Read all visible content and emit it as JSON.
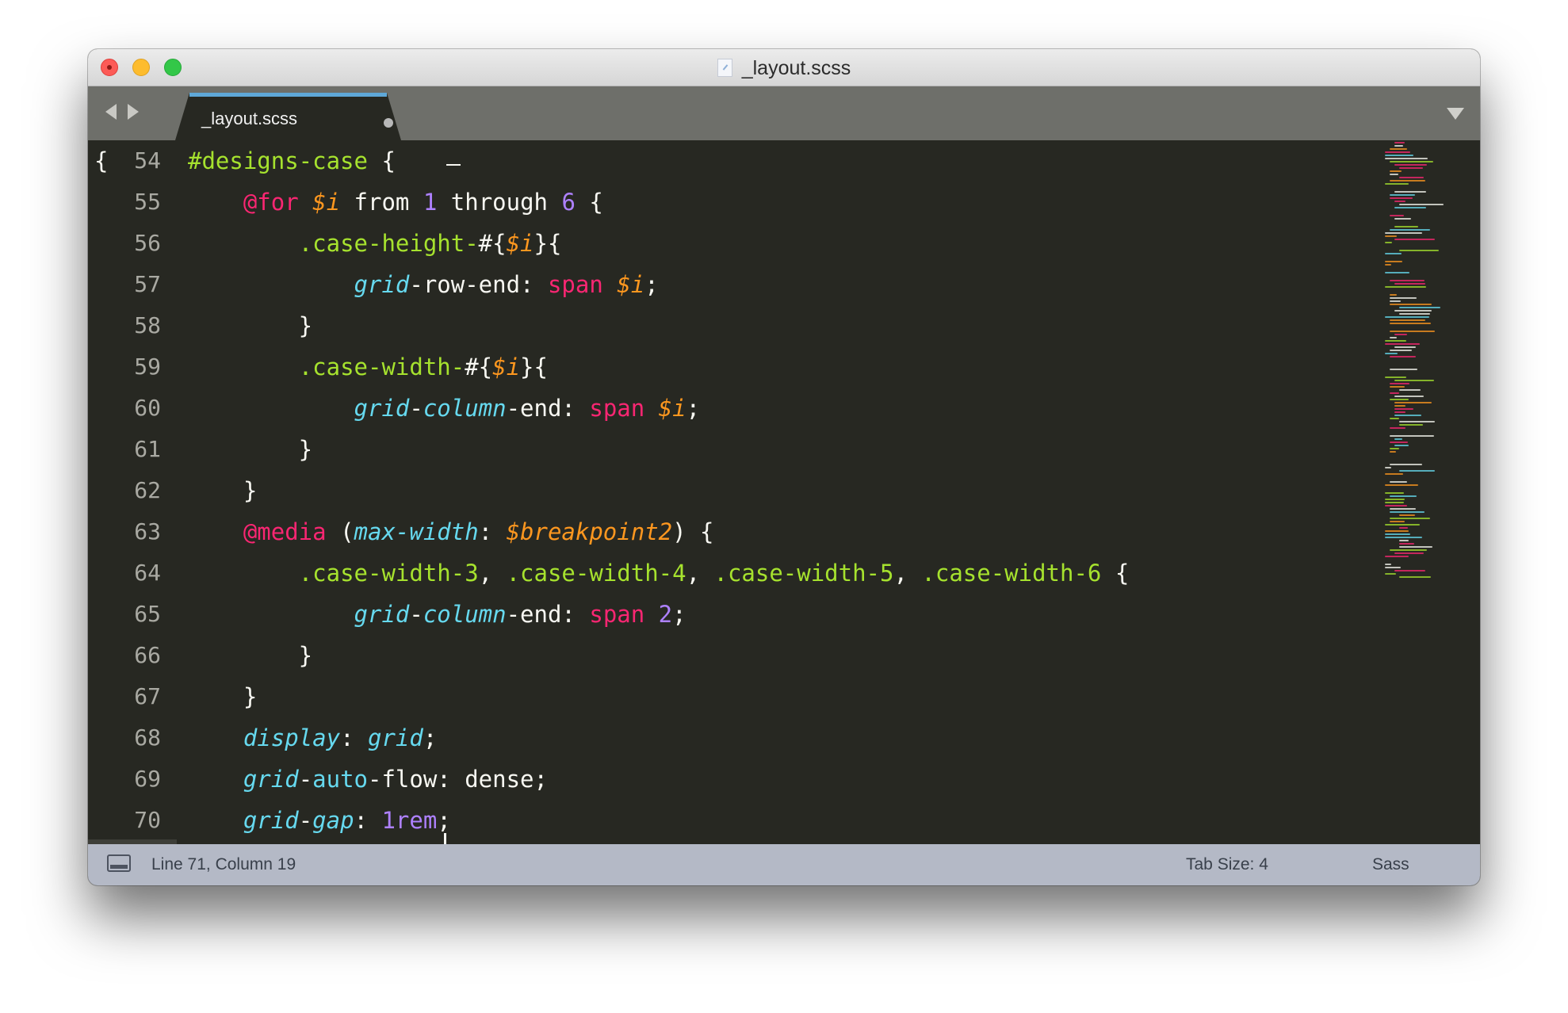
{
  "window": {
    "title": "_layout.scss"
  },
  "tabs": [
    {
      "label": "_layout.scss",
      "modified": true
    }
  ],
  "editor": {
    "fold_marker": "{",
    "lines": [
      {
        "num": "54",
        "tokens": [
          [
            "g",
            "#designs-case"
          ],
          [
            "w",
            " {"
          ]
        ]
      },
      {
        "num": "55",
        "tokens": [
          [
            "w",
            "    "
          ],
          [
            "p",
            "@for"
          ],
          [
            "w",
            " "
          ],
          [
            "o",
            "$i"
          ],
          [
            "w",
            " from "
          ],
          [
            "n",
            "1"
          ],
          [
            "w",
            " through "
          ],
          [
            "n",
            "6"
          ],
          [
            "w",
            " {"
          ]
        ]
      },
      {
        "num": "56",
        "tokens": [
          [
            "w",
            "        "
          ],
          [
            "g",
            ".case-height-"
          ],
          [
            "w",
            "#{"
          ],
          [
            "o",
            "$i"
          ],
          [
            "w",
            "}{"
          ]
        ]
      },
      {
        "num": "57",
        "tokens": [
          [
            "w",
            "            "
          ],
          [
            "ci",
            "grid"
          ],
          [
            "w",
            "-row-end: "
          ],
          [
            "p",
            "span"
          ],
          [
            "w",
            " "
          ],
          [
            "o",
            "$i"
          ],
          [
            "w",
            ";"
          ]
        ]
      },
      {
        "num": "58",
        "tokens": [
          [
            "w",
            "        }"
          ]
        ]
      },
      {
        "num": "59",
        "tokens": [
          [
            "w",
            "        "
          ],
          [
            "g",
            ".case-width-"
          ],
          [
            "w",
            "#{"
          ],
          [
            "o",
            "$i"
          ],
          [
            "w",
            "}{"
          ]
        ]
      },
      {
        "num": "60",
        "tokens": [
          [
            "w",
            "            "
          ],
          [
            "ci",
            "grid"
          ],
          [
            "w",
            "-"
          ],
          [
            "ci",
            "column"
          ],
          [
            "w",
            "-end: "
          ],
          [
            "p",
            "span"
          ],
          [
            "w",
            " "
          ],
          [
            "o",
            "$i"
          ],
          [
            "w",
            ";"
          ]
        ]
      },
      {
        "num": "61",
        "tokens": [
          [
            "w",
            "        }"
          ]
        ]
      },
      {
        "num": "62",
        "tokens": [
          [
            "w",
            "    }"
          ]
        ]
      },
      {
        "num": "63",
        "tokens": [
          [
            "w",
            "    "
          ],
          [
            "p",
            "@media"
          ],
          [
            "w",
            " ("
          ],
          [
            "ci",
            "max-width"
          ],
          [
            "w",
            ": "
          ],
          [
            "o",
            "$breakpoint2"
          ],
          [
            "w",
            ") {"
          ]
        ]
      },
      {
        "num": "64",
        "tokens": [
          [
            "w",
            "        "
          ],
          [
            "g",
            ".case-width-3"
          ],
          [
            "w",
            ", "
          ],
          [
            "g",
            ".case-width-4"
          ],
          [
            "w",
            ", "
          ],
          [
            "g",
            ".case-width-5"
          ],
          [
            "w",
            ", "
          ],
          [
            "g",
            ".case-width-6"
          ],
          [
            "w",
            " {"
          ]
        ]
      },
      {
        "num": "65",
        "tokens": [
          [
            "w",
            "            "
          ],
          [
            "ci",
            "grid"
          ],
          [
            "w",
            "-"
          ],
          [
            "ci",
            "column"
          ],
          [
            "w",
            "-end: "
          ],
          [
            "p",
            "span"
          ],
          [
            "w",
            " "
          ],
          [
            "n",
            "2"
          ],
          [
            "w",
            ";"
          ]
        ]
      },
      {
        "num": "66",
        "tokens": [
          [
            "w",
            "        }"
          ]
        ]
      },
      {
        "num": "67",
        "tokens": [
          [
            "w",
            "    }"
          ]
        ]
      },
      {
        "num": "68",
        "tokens": [
          [
            "w",
            "    "
          ],
          [
            "ci",
            "display"
          ],
          [
            "w",
            ": "
          ],
          [
            "ci",
            "grid"
          ],
          [
            "w",
            ";"
          ]
        ]
      },
      {
        "num": "69",
        "tokens": [
          [
            "w",
            "    "
          ],
          [
            "ci",
            "grid"
          ],
          [
            "w",
            "-"
          ],
          [
            "c",
            "auto"
          ],
          [
            "w",
            "-flow: dense;"
          ]
        ]
      },
      {
        "num": "70",
        "tokens": [
          [
            "w",
            "    "
          ],
          [
            "ci",
            "grid"
          ],
          [
            "w",
            "-"
          ],
          [
            "ci",
            "gap"
          ],
          [
            "w",
            ": "
          ],
          [
            "n",
            "1rem"
          ],
          [
            "w",
            ";"
          ]
        ]
      }
    ]
  },
  "status": {
    "position": "Line 71, Column 19",
    "tab_size": "Tab Size: 4",
    "syntax": "Sass"
  },
  "colors": {
    "background": "#272822",
    "foreground": "#f8f8f2",
    "selector": "#a6e22e",
    "keyword": "#f92672",
    "property": "#66d9ef",
    "variable": "#fd971f",
    "number": "#ae81ff",
    "tab_accent": "#5fa8d8",
    "statusbar": "#b4b9c6"
  },
  "icons": [
    "close-button",
    "minimize-button",
    "zoom-button",
    "document-icon",
    "chevron-left-icon",
    "chevron-right-icon",
    "tab-dropdown-icon",
    "panel-toggle-icon"
  ]
}
